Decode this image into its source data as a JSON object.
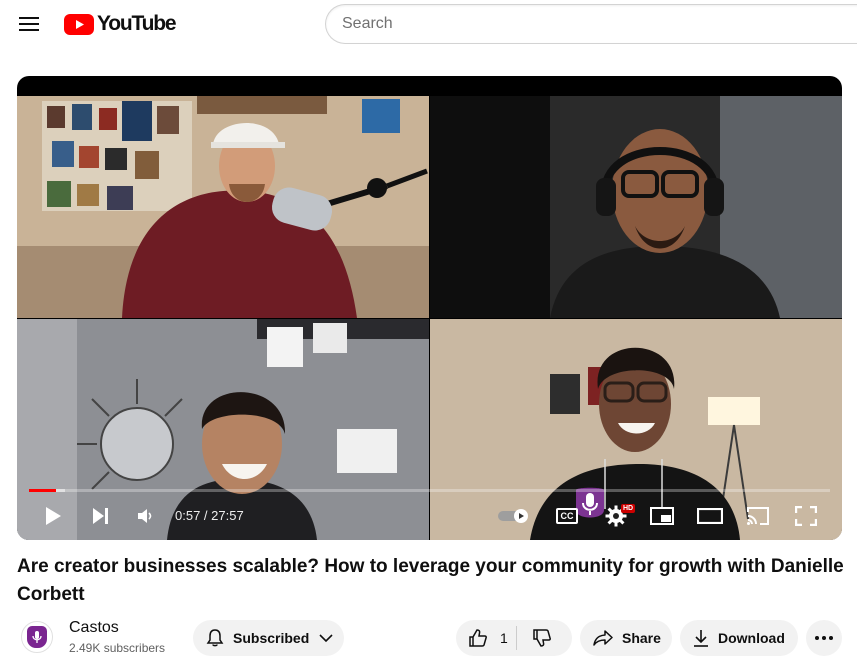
{
  "header": {
    "logo_text": "YouTube",
    "search_placeholder": "Search",
    "brand_color": "#ff0000"
  },
  "player": {
    "current_time": "0:57",
    "duration": "27:57",
    "time_display": "0:57 / 27:57",
    "progress_fraction": 0.034,
    "buffer_fraction": 0.045,
    "cc_label": "CC",
    "hd_badge": "HD"
  },
  "video": {
    "title": "Are creator businesses scalable? How to leverage your community for growth with Danielle Corbett"
  },
  "channel": {
    "name": "Castos",
    "subscribers": "2.49K subscribers",
    "avatar_color": "#7a2590"
  },
  "actions": {
    "subscribe_label": "Subscribed",
    "like_count": "1",
    "share_label": "Share",
    "download_label": "Download"
  }
}
